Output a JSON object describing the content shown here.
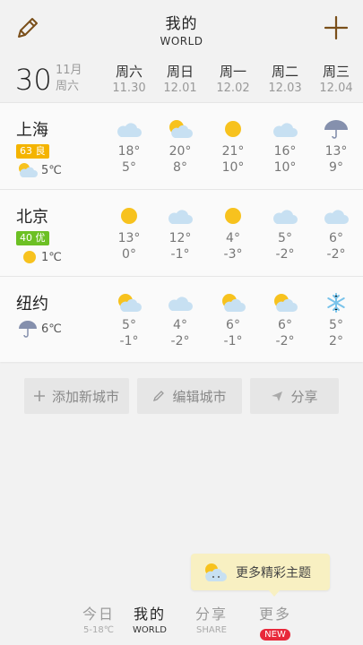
{
  "header": {
    "title": "我的",
    "subtitle": "WORLD"
  },
  "date": {
    "day": "30",
    "month": "11月",
    "weekday": "周六"
  },
  "forecast_days": [
    {
      "weekday": "周六",
      "date": "11.30"
    },
    {
      "weekday": "周日",
      "date": "12.01"
    },
    {
      "weekday": "周一",
      "date": "12.02"
    },
    {
      "weekday": "周二",
      "date": "12.03"
    },
    {
      "weekday": "周三",
      "date": "12.04"
    }
  ],
  "cities": [
    {
      "name": "上海",
      "aqi": {
        "label": "63 良",
        "color": "#f4b400"
      },
      "current": {
        "icon": "partly-cloudy-icon",
        "temp": "5℃"
      },
      "forecast": [
        {
          "icon": "cloud-icon",
          "hi": "18°",
          "lo": "5°"
        },
        {
          "icon": "partly-cloudy-icon",
          "hi": "20°",
          "lo": "8°"
        },
        {
          "icon": "sun-icon",
          "hi": "21°",
          "lo": "10°"
        },
        {
          "icon": "cloud-icon",
          "hi": "16°",
          "lo": "10°"
        },
        {
          "icon": "umbrella-icon",
          "hi": "13°",
          "lo": "9°"
        }
      ]
    },
    {
      "name": "北京",
      "aqi": {
        "label": "40 优",
        "color": "#6cc024"
      },
      "current": {
        "icon": "sun-icon",
        "temp": "1℃"
      },
      "forecast": [
        {
          "icon": "sun-icon",
          "hi": "13°",
          "lo": "0°"
        },
        {
          "icon": "cloud-icon",
          "hi": "12°",
          "lo": "-1°"
        },
        {
          "icon": "sun-icon",
          "hi": "4°",
          "lo": "-3°"
        },
        {
          "icon": "cloud-icon",
          "hi": "5°",
          "lo": "-2°"
        },
        {
          "icon": "cloud-icon",
          "hi": "6°",
          "lo": "-2°"
        }
      ]
    },
    {
      "name": "纽约",
      "aqi": null,
      "current": {
        "icon": "umbrella-icon",
        "temp": "6℃"
      },
      "forecast": [
        {
          "icon": "partly-cloudy-icon",
          "hi": "5°",
          "lo": "-1°"
        },
        {
          "icon": "cloud-icon",
          "hi": "4°",
          "lo": "-2°"
        },
        {
          "icon": "partly-cloudy-icon",
          "hi": "6°",
          "lo": "-1°"
        },
        {
          "icon": "partly-cloudy-icon",
          "hi": "6°",
          "lo": "-2°"
        },
        {
          "icon": "snowflake-icon",
          "hi": "5°",
          "lo": "2°"
        }
      ]
    }
  ],
  "actions": {
    "add_city": "添加新城市",
    "edit_city": "编辑城市",
    "share": "分享"
  },
  "promo": {
    "text": "更多精彩主题"
  },
  "tabs": [
    {
      "label": "今日",
      "sub": "5-18℃"
    },
    {
      "label": "我的",
      "sub": "WORLD"
    },
    {
      "label": "分享",
      "sub": "SHARE"
    },
    {
      "label": "更多",
      "badge": "NEW"
    }
  ],
  "colors": {
    "sun": "#f7c21e",
    "cloud": "#c7e0f2",
    "umbrella": "#8590ad",
    "snow": "#79c3ea",
    "accent": "#8a5a1e"
  }
}
